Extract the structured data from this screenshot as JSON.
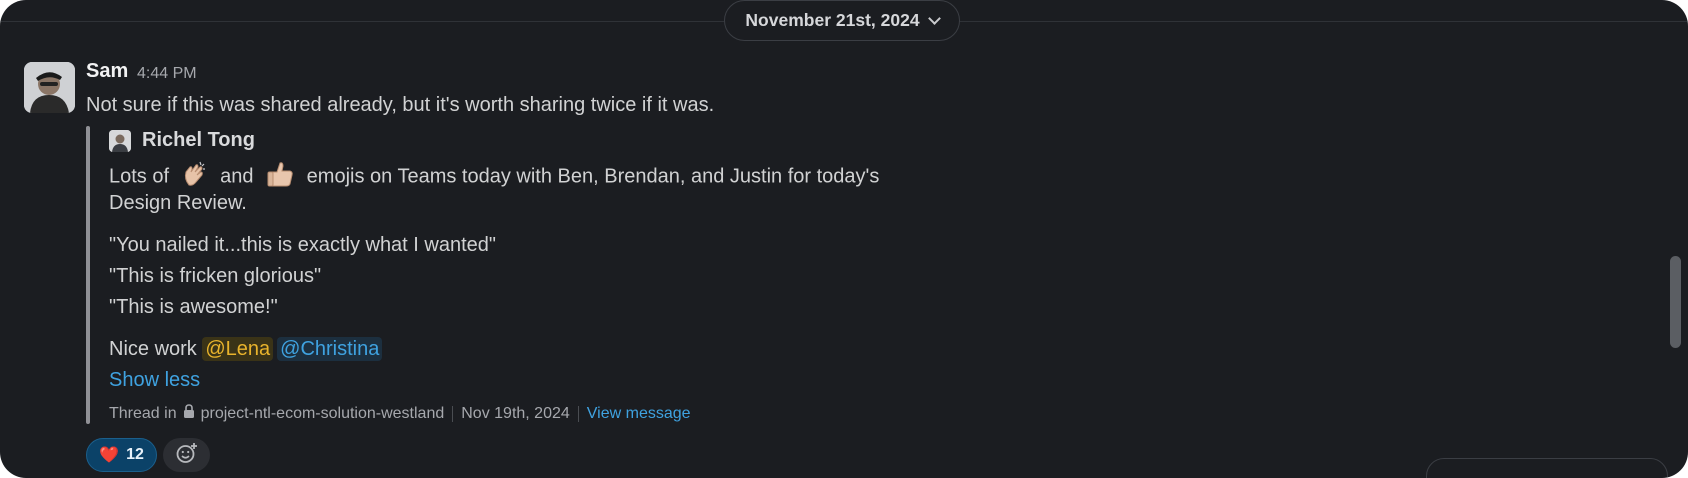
{
  "date_divider": {
    "label": "November 21st, 2024"
  },
  "message": {
    "author": "Sam",
    "time": "4:44 PM",
    "text": "Not sure if this was shared already, but it's worth sharing twice if it was."
  },
  "shared": {
    "author": "Richel Tong",
    "line1_a": "Lots of",
    "line1_b": "and",
    "line1_c": "emojis on Teams today with Ben, Brendan, and Justin for today's",
    "line2": "Design Review.",
    "quote1": "\"You nailed it...this is exactly what I wanted\"",
    "quote2": "\"This is fricken glorious\"",
    "quote3": "\"This is awesome!\"",
    "nice_work": "Nice work",
    "mention1": "@Lena",
    "mention2": "@Christina",
    "show_less": "Show less",
    "thread_in": "Thread in",
    "channel": "project-ntl-ecom-solution-westland",
    "thread_date": "Nov 19th, 2024",
    "view_message": "View message"
  },
  "reaction": {
    "emoji": "❤️",
    "count": "12"
  },
  "icons": {
    "clap": "clapping-hands-icon",
    "thumbs": "thumbs-up-icon",
    "lock": "lock-icon",
    "add_reaction": "add-reaction-icon"
  },
  "colors": {
    "background": "#1b1d21",
    "link": "#3fa2e0",
    "mention_highlight": "#e8b32c",
    "reaction_bg": "#0b4268"
  }
}
